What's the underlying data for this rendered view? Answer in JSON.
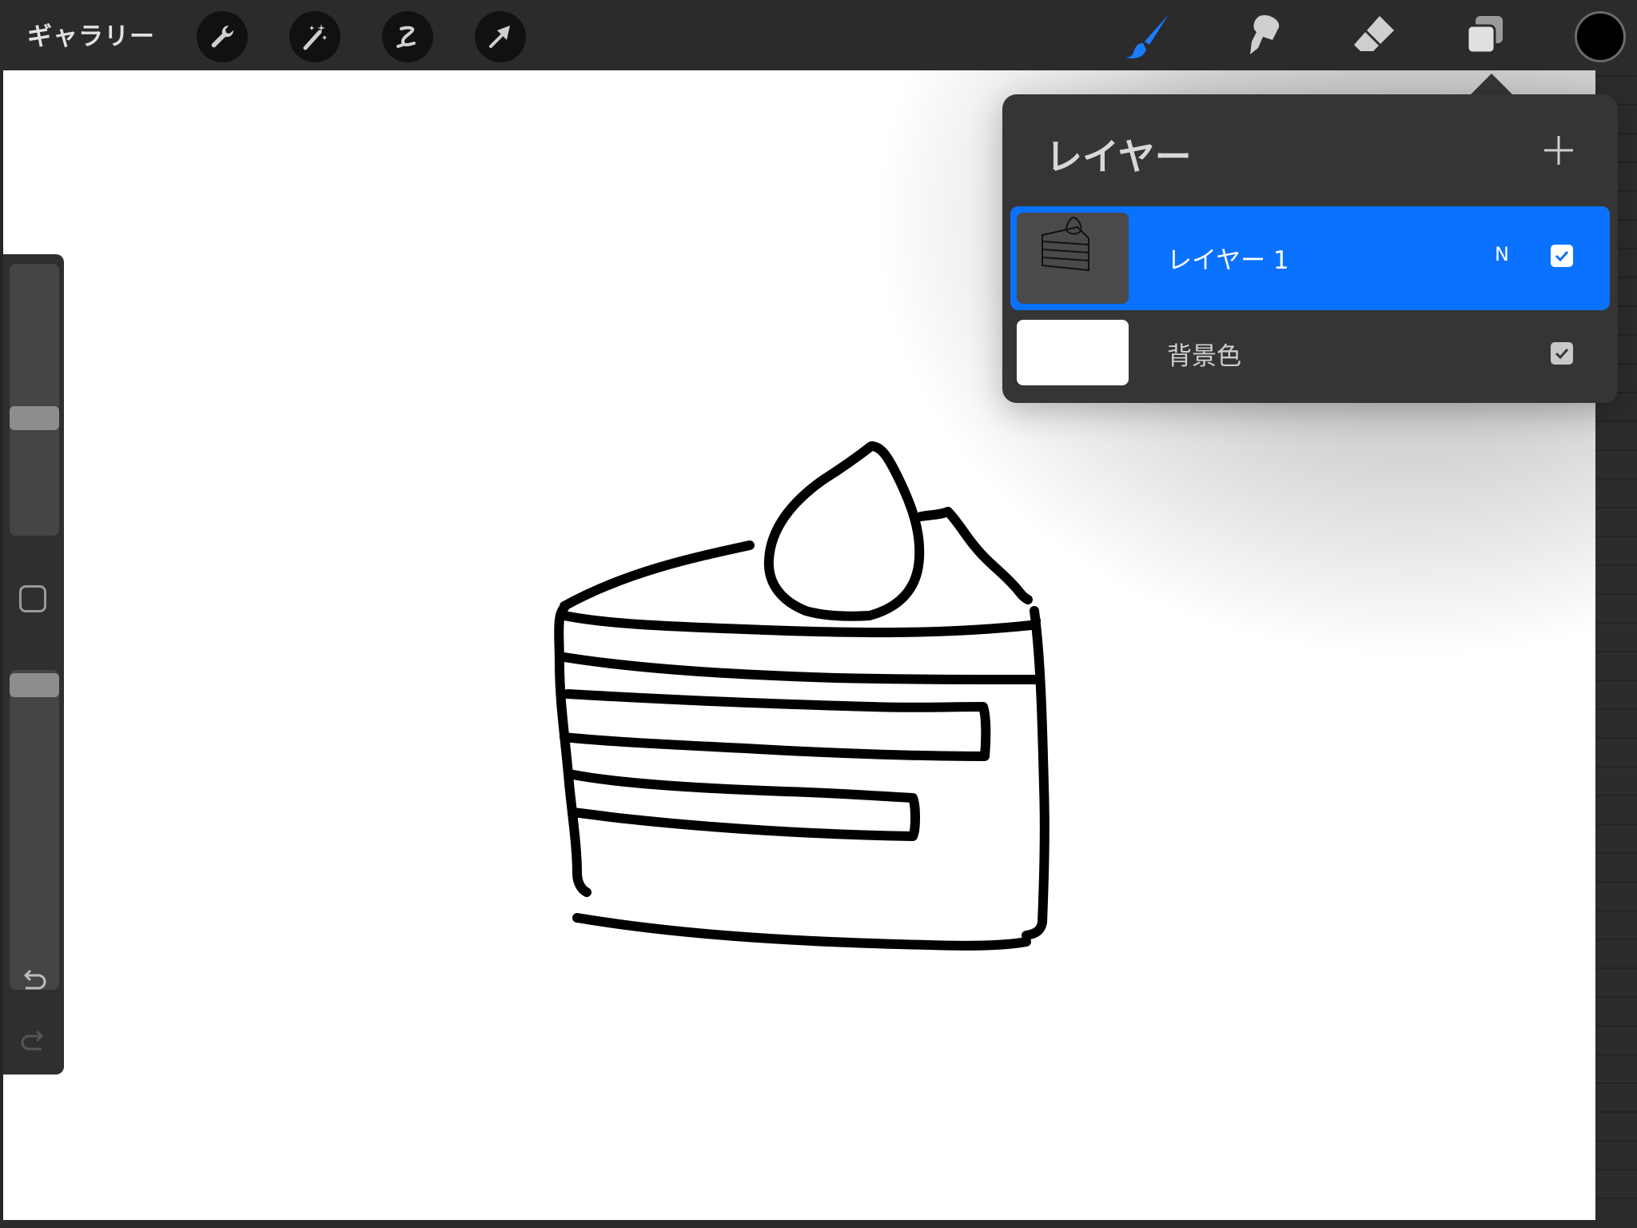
{
  "toolbar": {
    "gallery_label": "ギャラリー",
    "left_tools": [
      "wrench-icon",
      "magic-wand-icon",
      "selection-icon",
      "transform-arrow-icon"
    ],
    "right_tools": [
      "brush-icon",
      "smudge-icon",
      "eraser-icon",
      "layers-icon"
    ],
    "active_tool": "brush-icon",
    "accent_color": "#1a7bff",
    "current_color": "#000000"
  },
  "sidebar": {
    "brush_size_level": 0.45,
    "opacity_level": 0.04
  },
  "layers_panel": {
    "title": "レイヤー",
    "layers": [
      {
        "name": "レイヤー 1",
        "blend_mode": "N",
        "visible": true,
        "selected": true
      },
      {
        "name": "背景色",
        "visible": true,
        "selected": false,
        "color": "#ffffff"
      }
    ],
    "selected_color": "#0a72ff"
  }
}
